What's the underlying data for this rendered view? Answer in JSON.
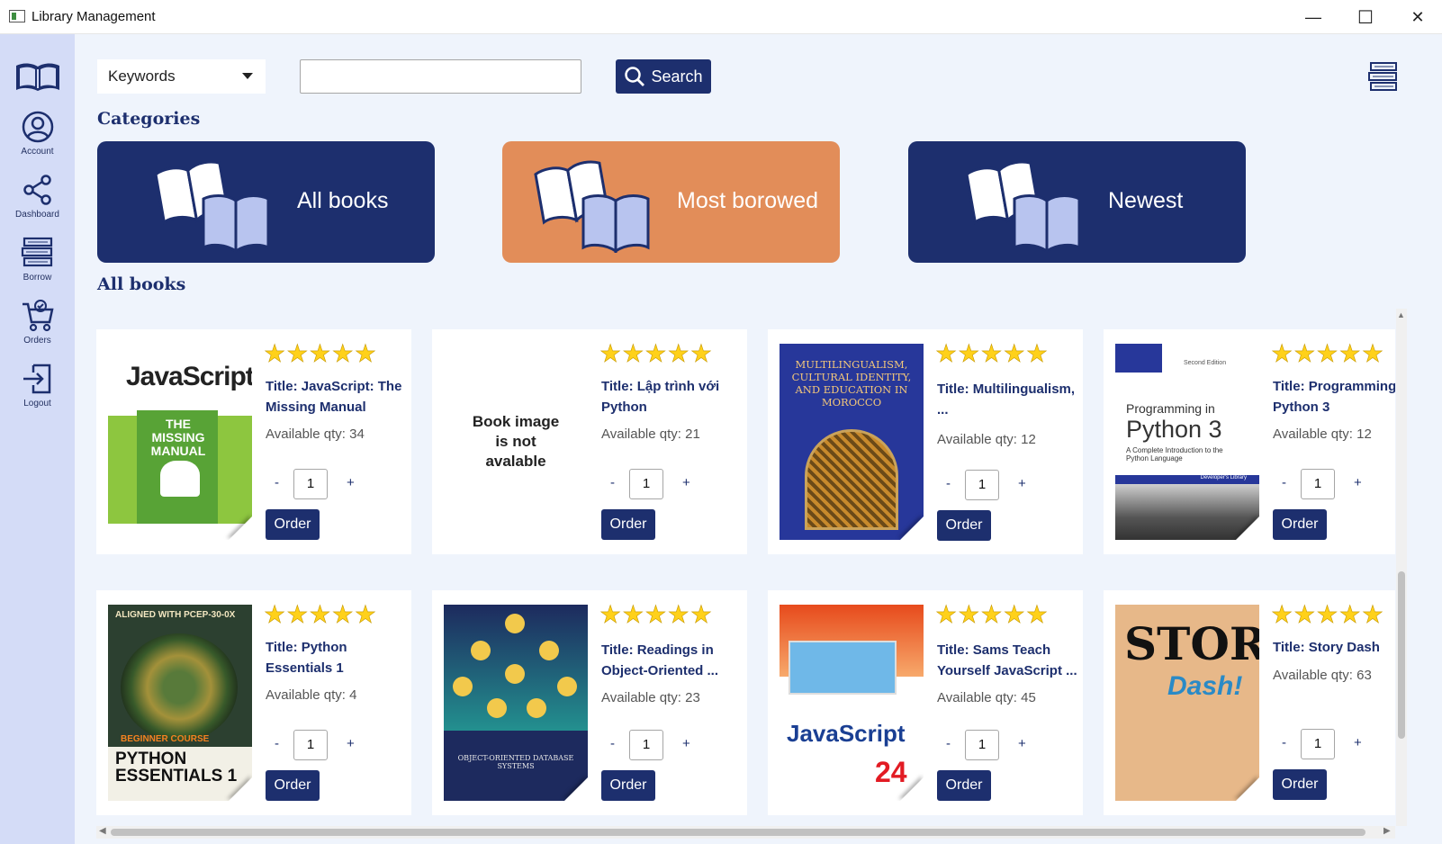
{
  "window": {
    "title": "Library Management",
    "minimize": "—",
    "maximize": "☐",
    "close": "✕"
  },
  "sidebar": {
    "items": [
      {
        "label": "Account",
        "icon": "account-icon"
      },
      {
        "label": "Dashboard",
        "icon": "share-icon"
      },
      {
        "label": "Borrow",
        "icon": "books-stack-icon"
      },
      {
        "label": "Orders",
        "icon": "cart-icon"
      },
      {
        "label": "Logout",
        "icon": "logout-icon"
      }
    ]
  },
  "toolbar": {
    "filter_value": "Keywords",
    "search_value": "",
    "search_placeholder": "",
    "search_label": "Search"
  },
  "categories_heading": "Categories",
  "categories": [
    {
      "label": "All books",
      "color": "#1d2f6e"
    },
    {
      "label": "Most borowed",
      "color": "#e28d59"
    },
    {
      "label": "Newest",
      "color": "#1d2f6e"
    }
  ],
  "list_heading": "All books",
  "rating": "★★★★★",
  "books": [
    {
      "title": "Title: JavaScript: The Missing Manual",
      "qty": "Available qty: 34",
      "count": "1",
      "cover": {
        "title": "JavaScript",
        "subtitle": "THE MISSING MANUAL"
      }
    },
    {
      "title": "Title: Lập trình với Python",
      "qty": "Available qty: 21",
      "count": "1",
      "cover": {
        "placeholder": "Book image is not avalable"
      }
    },
    {
      "title": "Title: Multilingualism, ...",
      "qty": "Available qty: 12",
      "count": "1",
      "cover": {
        "title": "MULTILINGUALISM, CULTURAL IDENTITY, AND EDUCATION IN MOROCCO"
      }
    },
    {
      "title": "Title: Programming in Python 3",
      "qty": "Available qty: 12",
      "count": "1",
      "cover": {
        "edition": "Second Edition",
        "line1": "Programming in",
        "line2": "Python 3",
        "line3": "A Complete Introduction to the Python Language",
        "series": "Developer's Library"
      }
    },
    {
      "title": "Title: Python Essentials 1",
      "qty": "Available qty: 4",
      "count": "1",
      "cover": {
        "top": "ALIGNED WITH PCEP-30-0X",
        "course": "BEGINNER COURSE",
        "title": "PYTHON ESSENTIALS 1"
      }
    },
    {
      "title": "Title: Readings in Object-Oriented ...",
      "qty": "Available qty: 23",
      "count": "1",
      "cover": {
        "title": "OBJECT-ORIENTED DATABASE SYSTEMS"
      }
    },
    {
      "title": "Title: Sams Teach Yourself JavaScript ...",
      "qty": "Available qty: 45",
      "count": "1",
      "cover": {
        "title": "JavaScript",
        "number": "24"
      }
    },
    {
      "title": "Title: Story Dash",
      "qty": "Available qty: 63",
      "count": "1",
      "cover": {
        "title": "STORY",
        "subtitle": "Dash!"
      }
    }
  ],
  "order_label": "Order",
  "minus": "-",
  "plus": "+"
}
